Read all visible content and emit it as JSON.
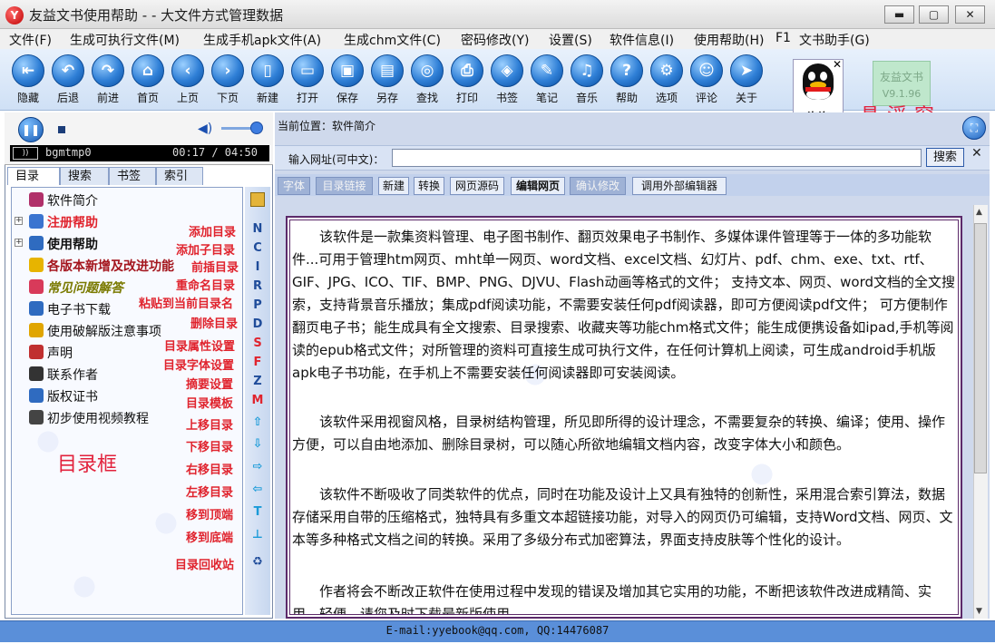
{
  "window": {
    "title": "友益文书使用帮助 - - 大文件方式管理数据",
    "controls": {
      "minimize": "▬",
      "maximize": "▢",
      "close": "✕"
    }
  },
  "menu": [
    "文件(F)",
    "生成可执行文件(M)",
    "生成手机apk文件(A)",
    "生成chm文件(C)",
    "密码修改(Y)",
    "设置(S)",
    "软件信息(I)",
    "使用帮助(H)",
    "F1",
    "文书助手(G)"
  ],
  "toolbar": [
    {
      "label": "隐藏",
      "icon": "hide-icon",
      "glyph": "⇤"
    },
    {
      "label": "后退",
      "icon": "back-icon",
      "glyph": "↶"
    },
    {
      "label": "前进",
      "icon": "forward-icon",
      "glyph": "↷"
    },
    {
      "label": "首页",
      "icon": "home-icon",
      "glyph": "⌂"
    },
    {
      "label": "上页",
      "icon": "prev-page-icon",
      "glyph": "‹"
    },
    {
      "label": "下页",
      "icon": "next-page-icon",
      "glyph": "›"
    },
    {
      "label": "新建",
      "icon": "new-icon",
      "glyph": "▯"
    },
    {
      "label": "打开",
      "icon": "open-icon",
      "glyph": "▭"
    },
    {
      "label": "保存",
      "icon": "save-icon",
      "glyph": "▣"
    },
    {
      "label": "另存",
      "icon": "save-as-icon",
      "glyph": "▤"
    },
    {
      "label": "查找",
      "icon": "find-icon",
      "glyph": "◎"
    },
    {
      "label": "打印",
      "icon": "print-icon",
      "glyph": "⎙"
    },
    {
      "label": "书签",
      "icon": "bookmark-icon",
      "glyph": "◈"
    },
    {
      "label": "笔记",
      "icon": "note-icon",
      "glyph": "✎"
    },
    {
      "label": "音乐",
      "icon": "music-icon",
      "glyph": "♫"
    },
    {
      "label": "帮助",
      "icon": "help-icon",
      "glyph": "?"
    },
    {
      "label": "选项",
      "icon": "options-icon",
      "glyph": "⚙"
    },
    {
      "label": "评论",
      "icon": "comment-icon",
      "glyph": "☺"
    },
    {
      "label": "关于",
      "icon": "about-icon",
      "glyph": "➤"
    }
  ],
  "qq": {
    "label": "咨询",
    "close": "✕",
    "icon": "qq-penguin-icon"
  },
  "version": {
    "name": "友益文书",
    "number": "V9.1.96"
  },
  "float_label": "悬浮窗",
  "player": {
    "track": "bgmtmp0",
    "time": "00:17 / 04:50"
  },
  "left_tabs": [
    "目录",
    "搜索",
    "书签",
    "索引"
  ],
  "tree": [
    {
      "label": "软件简介",
      "color": "#111111",
      "bold": false,
      "italic": false,
      "expand": false,
      "icon": "book-icon",
      "iconColor": "#b0306a"
    },
    {
      "label": "注册帮助",
      "color": "#e0242e",
      "bold": true,
      "italic": false,
      "expand": true,
      "icon": "key-icon",
      "iconColor": "#3a74d0"
    },
    {
      "label": "使用帮助",
      "color": "#111111",
      "bold": true,
      "italic": false,
      "expand": true,
      "icon": "book-icon",
      "iconColor": "#2f6bc0"
    },
    {
      "label": "各版本新增及改进功能",
      "color": "#a4161e",
      "bold": true,
      "italic": false,
      "expand": false,
      "icon": "star-icon",
      "iconColor": "#e7b400"
    },
    {
      "label": "常见问题解答",
      "color": "#7a7a00",
      "bold": true,
      "italic": true,
      "expand": false,
      "icon": "question-icon",
      "iconColor": "#d83a5a"
    },
    {
      "label": "电子书下载",
      "color": "#111111",
      "bold": false,
      "italic": false,
      "expand": false,
      "icon": "globe-icon",
      "iconColor": "#2f6bc0"
    },
    {
      "label": "使用破解版注意事项",
      "color": "#111111",
      "bold": false,
      "italic": false,
      "expand": false,
      "icon": "lock-icon",
      "iconColor": "#e0a500"
    },
    {
      "label": "声明",
      "color": "#111111",
      "bold": false,
      "italic": false,
      "expand": false,
      "icon": "apple-icon",
      "iconColor": "#c03030"
    },
    {
      "label": "联系作者",
      "color": "#111111",
      "bold": false,
      "italic": false,
      "expand": false,
      "icon": "books-icon",
      "iconColor": "#333333"
    },
    {
      "label": "版权证书",
      "color": "#111111",
      "bold": false,
      "italic": false,
      "expand": false,
      "icon": "globe-icon",
      "iconColor": "#2f6bc0"
    },
    {
      "label": "初步使用视频教程",
      "color": "#111111",
      "bold": false,
      "italic": false,
      "expand": false,
      "icon": "help-doc-icon",
      "iconColor": "#444444"
    }
  ],
  "annotations": [
    "添加目录",
    "添加子目录",
    "前插目录",
    "重命名目录",
    "粘贴到当前目录名",
    "删除目录",
    "目录属性设置",
    "目录字体设置",
    "摘要设置",
    "目录模板",
    "上移目录",
    "下移目录",
    "右移目录",
    "左移目录",
    "移到顶端",
    "移到底端",
    "目录回收站"
  ],
  "tree_label": "目录框",
  "vtools": [
    "N",
    "C",
    "I",
    "R",
    "P",
    "D",
    "S",
    "F",
    "Z",
    "M",
    "⇧",
    "⇩",
    "⇨",
    "⇦",
    "T",
    "⊥",
    "♻"
  ],
  "location": "当前位置：软件简介",
  "url": {
    "label": "输入网址(可中文)：",
    "value": "",
    "button": "搜索",
    "close": "✕"
  },
  "edit_buttons": [
    {
      "label": "字体",
      "disabled": true
    },
    {
      "label": "目录链接",
      "disabled": true
    },
    {
      "label": "新建",
      "disabled": false
    },
    {
      "label": "转换",
      "disabled": false
    },
    {
      "label": "网页源码",
      "disabled": false
    },
    {
      "label": "编辑网页",
      "disabled": false,
      "bold": true
    },
    {
      "label": "确认修改",
      "disabled": true
    },
    {
      "label": "调用外部编辑器",
      "disabled": false
    }
  ],
  "document": [
    "该软件是一款集资料管理、电子图书制作、翻页效果电子书制作、多媒体课件管理等于一体的多功能软件...可用于管理htm网页、mht单一网页、word文档、excel文档、幻灯片、pdf、chm、exe、txt、rtf、GIF、JPG、ICO、TIF、BMP、PNG、DJVU、Flash动画等格式的文件； 支持文本、网页、word文档的全文搜索，支持背景音乐播放；集成pdf阅读功能，不需要安装任何pdf阅读器，即可方便阅读pdf文件； 可方便制作翻页电子书；能生成具有全文搜索、目录搜索、收藏夹等功能chm格式文件；能生成便携设备如ipad,手机等阅读的epub格式文件；对所管理的资料可直接生成可执行文件，在任何计算机上阅读，可生成android手机版apk电子书功能，在手机上不需要安装任何阅读器即可安装阅读。",
    "该软件采用视窗风格，目录树结构管理，所见即所得的设计理念，不需要复杂的转换、编译；使用、操作方便，可以自由地添加、删除目录树，可以随心所欲地编辑文档内容，改变字体大小和颜色。",
    "该软件不断吸收了同类软件的优点，同时在功能及设计上又具有独特的创新性，采用混合索引算法，数据存储采用自带的压缩格式，独特具有多重文本超链接功能，对导入的网页仍可编辑，支持Word文档、网页、文本等多种格式文档之间的转换。采用了多级分布式加密算法，界面支持皮肤等个性化的设计。",
    "作者将会不断改正软件在使用过程中发现的错误及增加其它实用的功能，不断把该软件改进成精简、实用、轻便，请您及时下载最新版使用。"
  ],
  "status": "E-mail:yyebook@qq.com, QQ:14476087"
}
